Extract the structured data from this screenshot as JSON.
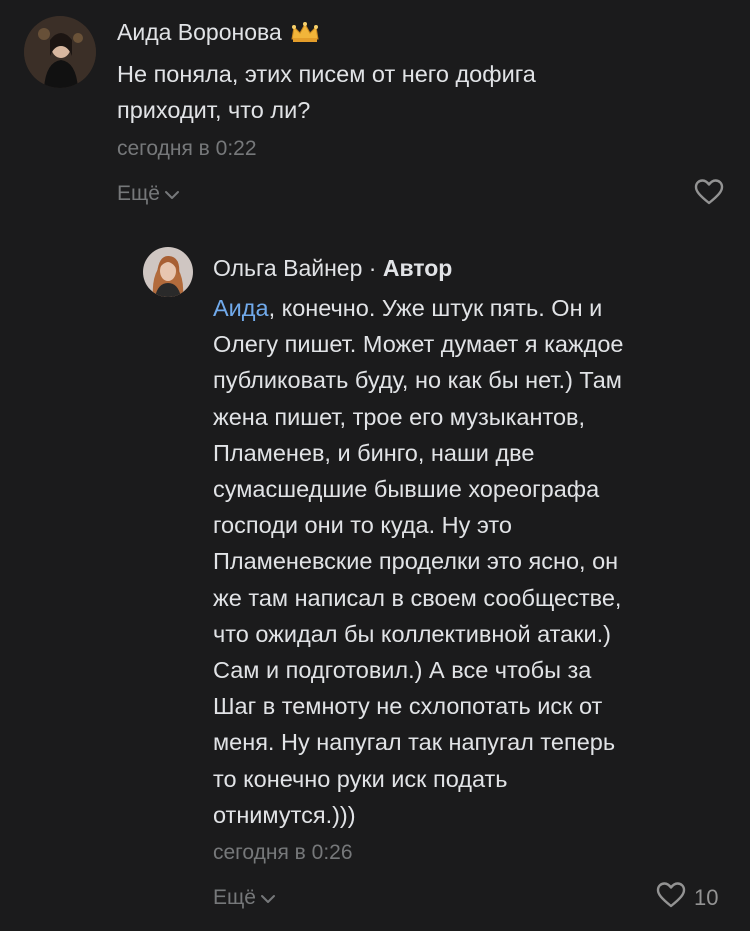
{
  "comments": [
    {
      "author": "Аида Воронова",
      "badge_icon": "crown-icon",
      "text": "Не поняла, этих писем от него дофига\nприходит, что ли?",
      "time": "сегодня в 0:22",
      "more_label": "Ещё",
      "likes": ""
    },
    {
      "author": "Ольга Вайнер",
      "separator": "·",
      "role": "Автор",
      "mention": "Аида",
      "text": ", конечно. Уже штук пять. Он и\nОлегу пишет. Может думает я каждое\nпубликовать буду, но как бы нет.) Там\nжена пишет, трое его музыкантов,\nПламенев, и бинго, наши две\nсумасшедшие бывшие хореографа\nгосподи они то куда. Ну это\nПламеневские проделки это ясно, он\nже там написал в своем сообществе,\nчто ожидал бы коллективной атаки.)\nСам и подготовил.) А все чтобы за\nШаг в темноту не схлопотать иск от\nменя. Ну напугал так напугал теперь\nто конечно руки иск подать\nотнимутся.)))",
      "time": "сегодня в 0:26",
      "more_label": "Ещё",
      "likes": "10"
    }
  ],
  "colors": {
    "background": "#1b1b1c",
    "text": "#e1e3e6",
    "secondary": "#76787a",
    "mention": "#71aaeb"
  }
}
